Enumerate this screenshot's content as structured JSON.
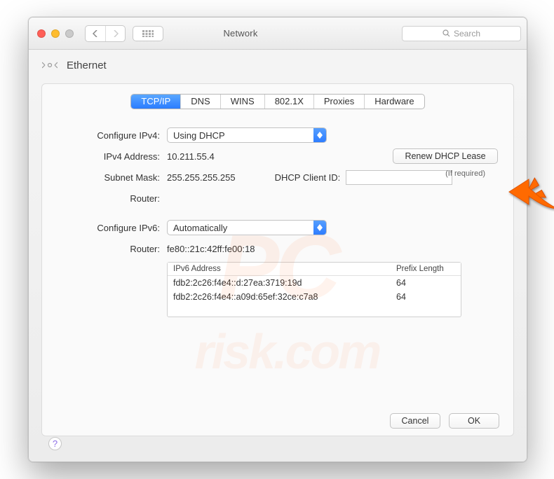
{
  "window_title": "Network",
  "search_placeholder": "Search",
  "breadcrumb_title": "Ethernet",
  "tabs": {
    "tcpip": "TCP/IP",
    "dns": "DNS",
    "wins": "WINS",
    "8021x": "802.1X",
    "proxies": "Proxies",
    "hardware": "Hardware"
  },
  "labels": {
    "configure_ipv4": "Configure IPv4:",
    "ipv4_address": "IPv4 Address:",
    "subnet_mask": "Subnet Mask:",
    "router": "Router:",
    "configure_ipv6": "Configure IPv6:",
    "ipv6_router": "Router:",
    "dhcp_client_id": "DHCP Client ID:",
    "if_required": "(If required)"
  },
  "values": {
    "configure_ipv4": "Using DHCP",
    "ipv4_address": "10.211.55.4",
    "subnet_mask": "255.255.255.255",
    "router_v4": "",
    "configure_ipv6": "Automatically",
    "ipv6_router": "fe80::21c:42ff:fe00:18",
    "dhcp_client_id": ""
  },
  "buttons": {
    "renew_dhcp": "Renew DHCP Lease",
    "cancel": "Cancel",
    "ok": "OK"
  },
  "ipv6_table": {
    "headers": {
      "address": "IPv6 Address",
      "prefix": "Prefix Length"
    },
    "rows": [
      {
        "address": "fdb2:2c26:f4e4::d:27ea:3719:19d",
        "prefix": "64"
      },
      {
        "address": "fdb2:2c26:f4e4::a09d:65ef:32ce:c7a8",
        "prefix": "64"
      }
    ]
  }
}
